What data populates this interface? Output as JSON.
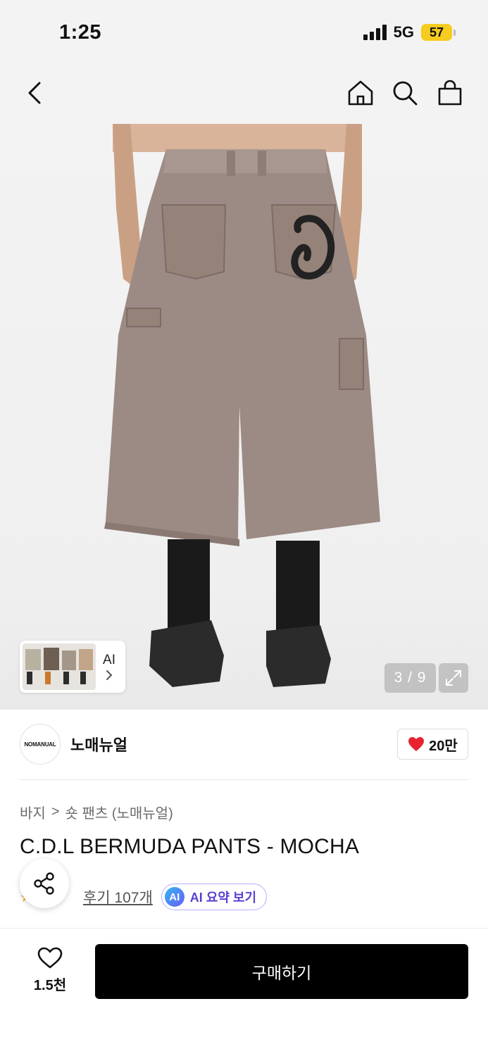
{
  "status_bar": {
    "time": "1:25",
    "network": "5G",
    "battery": "57"
  },
  "nav": {
    "back_icon": "chevron-left-icon",
    "home_icon": "home-icon",
    "search_icon": "search-icon",
    "cart_icon": "shopping-bag-icon"
  },
  "gallery": {
    "counter": "3 / 9",
    "ai_thumb_label": "AI"
  },
  "brand": {
    "logo_text": "NOMANUAL",
    "name": "노매뉴얼",
    "likes": "20만"
  },
  "breadcrumb": {
    "category": "바지",
    "separator": ">",
    "subcategory": "숏 팬츠 (노매뉴얼)"
  },
  "product": {
    "title": "C.D.L BERMUDA PANTS - MOCHA",
    "review_link": "후기 107개",
    "ai_badge": "AI",
    "ai_summary_label": "AI 요약 보기"
  },
  "bottom": {
    "wish_count": "1.5천",
    "buy_label": "구매하기"
  },
  "colors": {
    "accent_black": "#000000",
    "heart_red": "#e8232f",
    "battery_yellow": "#f5cc1f",
    "ai_purple": "#5b3fd1"
  }
}
